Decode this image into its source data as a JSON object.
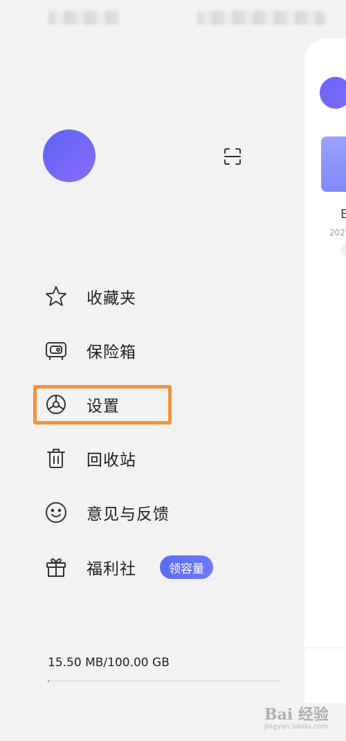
{
  "menu": {
    "items": [
      {
        "label": "收藏夹",
        "icon": "star-icon"
      },
      {
        "label": "保险箱",
        "icon": "safe-icon"
      },
      {
        "label": "设置",
        "icon": "settings-icon"
      },
      {
        "label": "回收站",
        "icon": "trash-icon"
      },
      {
        "label": "意见与反馈",
        "icon": "smile-icon"
      },
      {
        "label": "福利社",
        "icon": "gift-icon"
      }
    ],
    "welfare_badge": "领容量"
  },
  "storage": {
    "text": "15.50 MB/100.00 GB",
    "used_fraction": 0.0002
  },
  "right_panel": {
    "partial_title": "E",
    "partial_date": "202"
  },
  "watermark": {
    "main": "Bai 经验",
    "sub": "jingyan.baidu.com"
  },
  "colors": {
    "accent": "#5b63f5",
    "highlight": "#f4913a",
    "background": "#f2f2f2"
  }
}
